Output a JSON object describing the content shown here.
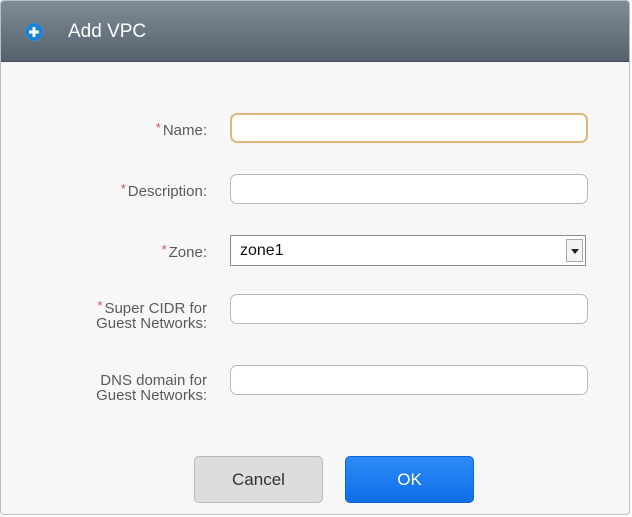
{
  "dialog": {
    "title": "Add VPC",
    "title_icon": "plus-circle-icon"
  },
  "form": {
    "name": {
      "label": "Name:",
      "required_mark": "*",
      "value": ""
    },
    "description": {
      "label": "Description:",
      "required_mark": "*",
      "value": ""
    },
    "zone": {
      "label": "Zone:",
      "required_mark": "*",
      "value": "zone1"
    },
    "super_cidr": {
      "label_line1": "Super CIDR for",
      "label_line2": "Guest Networks:",
      "required_mark": "*",
      "value": ""
    },
    "dns_domain": {
      "label_line1": "DNS domain for",
      "label_line2": "Guest Networks:",
      "value": ""
    }
  },
  "buttons": {
    "cancel": "Cancel",
    "ok": "OK"
  },
  "colors": {
    "header": "#55616d",
    "required": "#d64b4b",
    "primary": "#1f7ff2"
  }
}
